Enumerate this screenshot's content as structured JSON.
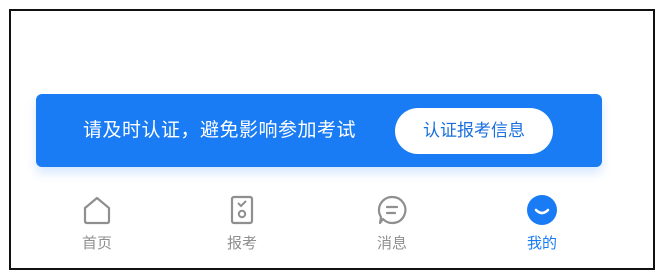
{
  "banner": {
    "text": "请及时认证，避免影响参加考试",
    "button_label": "认证报考信息"
  },
  "tabbar": {
    "active_color": "#1a7cf5",
    "inactive_color": "#8f8f8f",
    "items": [
      {
        "label": "首页",
        "icon": "home-icon",
        "active": false
      },
      {
        "label": "报考",
        "icon": "exam-form-icon",
        "active": false
      },
      {
        "label": "消息",
        "icon": "message-icon",
        "active": false
      },
      {
        "label": "我的",
        "icon": "profile-icon",
        "active": true
      }
    ]
  },
  "colors": {
    "banner_background": "#1a7cf5",
    "banner_text": "#ffffff",
    "button_background": "#ffffff",
    "button_text": "#1a6fe0"
  }
}
